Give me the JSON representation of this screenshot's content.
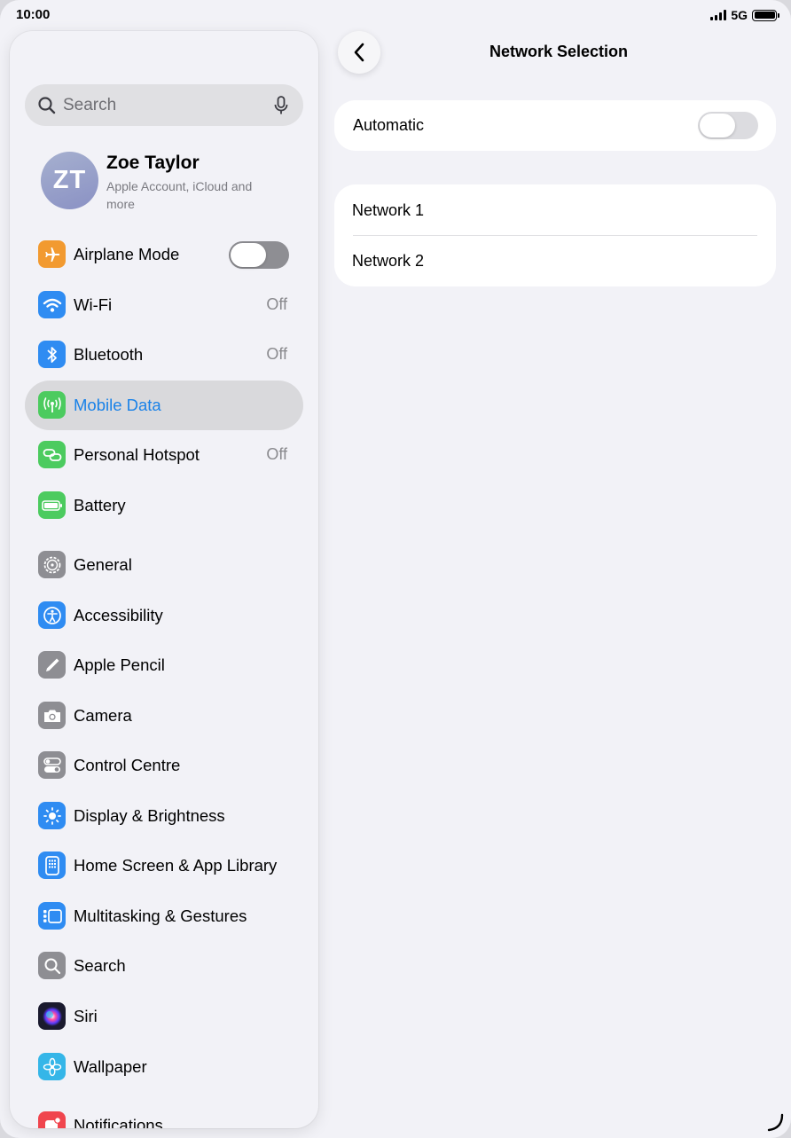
{
  "status_bar": {
    "time": "10:00",
    "network": "5G"
  },
  "sidebar": {
    "search_placeholder": "Search",
    "profile": {
      "initials": "ZT",
      "name": "Zoe Taylor",
      "subtitle": "Apple Account, iCloud and more"
    },
    "items": [
      {
        "label": "Airplane Mode",
        "icon": "airplane-icon",
        "color": "#f29a30",
        "toggle": "off"
      },
      {
        "label": "Wi-Fi",
        "icon": "wifi-icon",
        "color": "#2f8cf2",
        "value": "Off"
      },
      {
        "label": "Bluetooth",
        "icon": "bluetooth-icon",
        "color": "#2f8cf2",
        "value": "Off"
      },
      {
        "label": "Mobile Data",
        "icon": "antenna-icon",
        "color": "#4ccb5f",
        "selected": true
      },
      {
        "label": "Personal Hotspot",
        "icon": "hotspot-icon",
        "color": "#4ccb5f",
        "value": "Off"
      },
      {
        "label": "Battery",
        "icon": "battery-icon",
        "color": "#4ccb5f"
      },
      {
        "label": "General",
        "icon": "gear-icon",
        "color": "#8e8e93"
      },
      {
        "label": "Accessibility",
        "icon": "accessibility-icon",
        "color": "#2f8cf2"
      },
      {
        "label": "Apple Pencil",
        "icon": "pencil-icon",
        "color": "#8e8e93"
      },
      {
        "label": "Camera",
        "icon": "camera-icon",
        "color": "#8e8e93"
      },
      {
        "label": "Control Centre",
        "icon": "control-centre-icon",
        "color": "#8e8e93"
      },
      {
        "label": "Display & Brightness",
        "icon": "brightness-icon",
        "color": "#2f8cf2"
      },
      {
        "label": "Home Screen & App Library",
        "icon": "home-screen-icon",
        "color": "#2f8cf2"
      },
      {
        "label": "Multitasking & Gestures",
        "icon": "multitasking-icon",
        "color": "#2f8cf2"
      },
      {
        "label": "Search",
        "icon": "search-icon",
        "color": "#8e8e93"
      },
      {
        "label": "Siri",
        "icon": "siri-icon",
        "color": "#1a1a2e"
      },
      {
        "label": "Wallpaper",
        "icon": "wallpaper-icon",
        "color": "#35b6e8"
      },
      {
        "label": "Notifications",
        "icon": "notifications-icon",
        "color": "#f0454e"
      }
    ]
  },
  "detail": {
    "title": "Network Selection",
    "automatic": {
      "label": "Automatic",
      "toggle": "off"
    },
    "networks": [
      "Network 1",
      "Network 2"
    ]
  }
}
